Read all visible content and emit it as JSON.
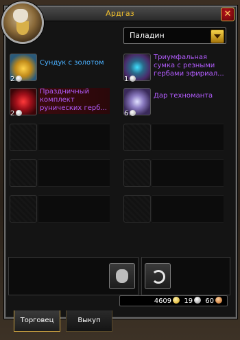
{
  "window": {
    "title": "Ардгаз",
    "close_icon": "close-icon"
  },
  "class_filter": {
    "selected": "Паладин"
  },
  "items": [
    {
      "name": "Сундук с золотом",
      "count": "2",
      "name_color": "#4ab0ff",
      "icon": "gold-chest-icon"
    },
    {
      "name": "Триумфальная сумка с резными гербами эфириал...",
      "count": "1",
      "name_color": "#b35cff",
      "icon": "triumph-bag-icon"
    },
    {
      "name": "Праздничный комплект рунических герб...",
      "count": "2",
      "name_color": "#b35cff",
      "icon": "rune-kit-icon"
    },
    {
      "name": "Дар техноманта",
      "count": "6",
      "name_color": "#b35cff",
      "icon": "technomancer-gift-icon"
    }
  ],
  "money": {
    "gold": "4609",
    "silver": "19",
    "copper": "60"
  },
  "tabs": [
    {
      "label": "Торговец",
      "active": true
    },
    {
      "label": "Выкуп",
      "active": false
    }
  ],
  "colors": {
    "gold": "#f2c12e",
    "silver": "#c0c0c0",
    "copper": "#c8741c"
  }
}
